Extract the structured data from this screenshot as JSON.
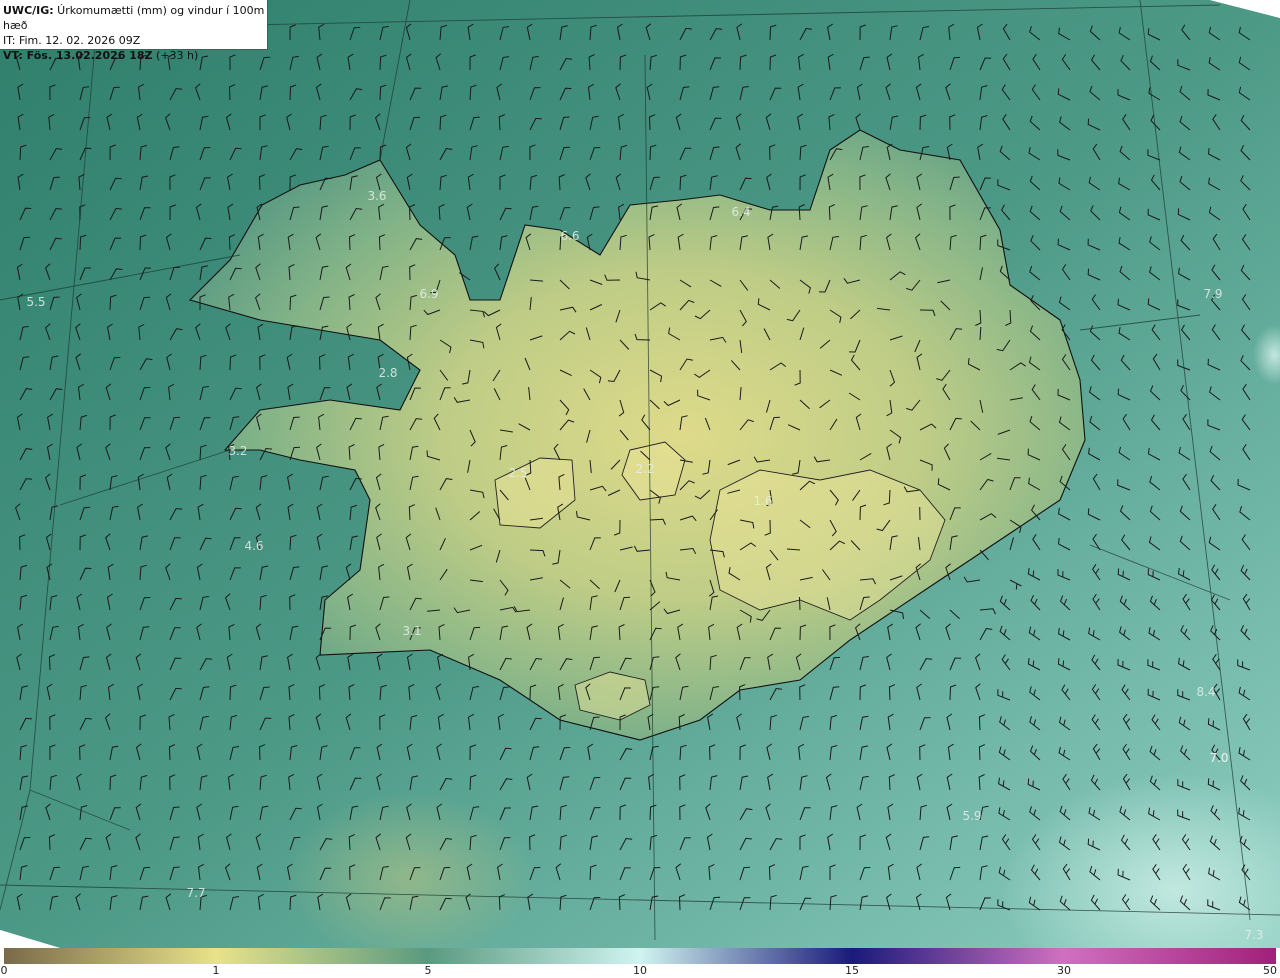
{
  "header": {
    "line1_prefix": "UWC/IG:",
    "line1_text": " Úrkomumætti (mm) og vindur í 100m hæð",
    "line2": "IT: Fim. 12. 02. 2026 09Z",
    "line3_prefix": "VT: Fös. 13.02.2026 18Z",
    "line3_suffix": " (+33 h)"
  },
  "colorbar": {
    "ticks": [
      "0",
      "1",
      "5",
      "10",
      "15",
      "30",
      "50"
    ],
    "colors": {
      "c0": "#7a6a4a",
      "c1": "#e8e28a",
      "c5": "#5a9a80",
      "c10": "#d0f4f0",
      "c15": "#1a1a7a",
      "c30": "#d070c0",
      "c50": "#a0207a"
    }
  },
  "map_labels": [
    "3.6",
    "6.4",
    "6.6",
    "6.9",
    "5.5",
    "2.8",
    "7.9",
    "7.0",
    "3.2",
    "4.6",
    "3.1",
    "8.4",
    "7.0",
    "5.9",
    "7.7",
    "7.3",
    "1.6",
    "2.2",
    "2.5"
  ]
}
